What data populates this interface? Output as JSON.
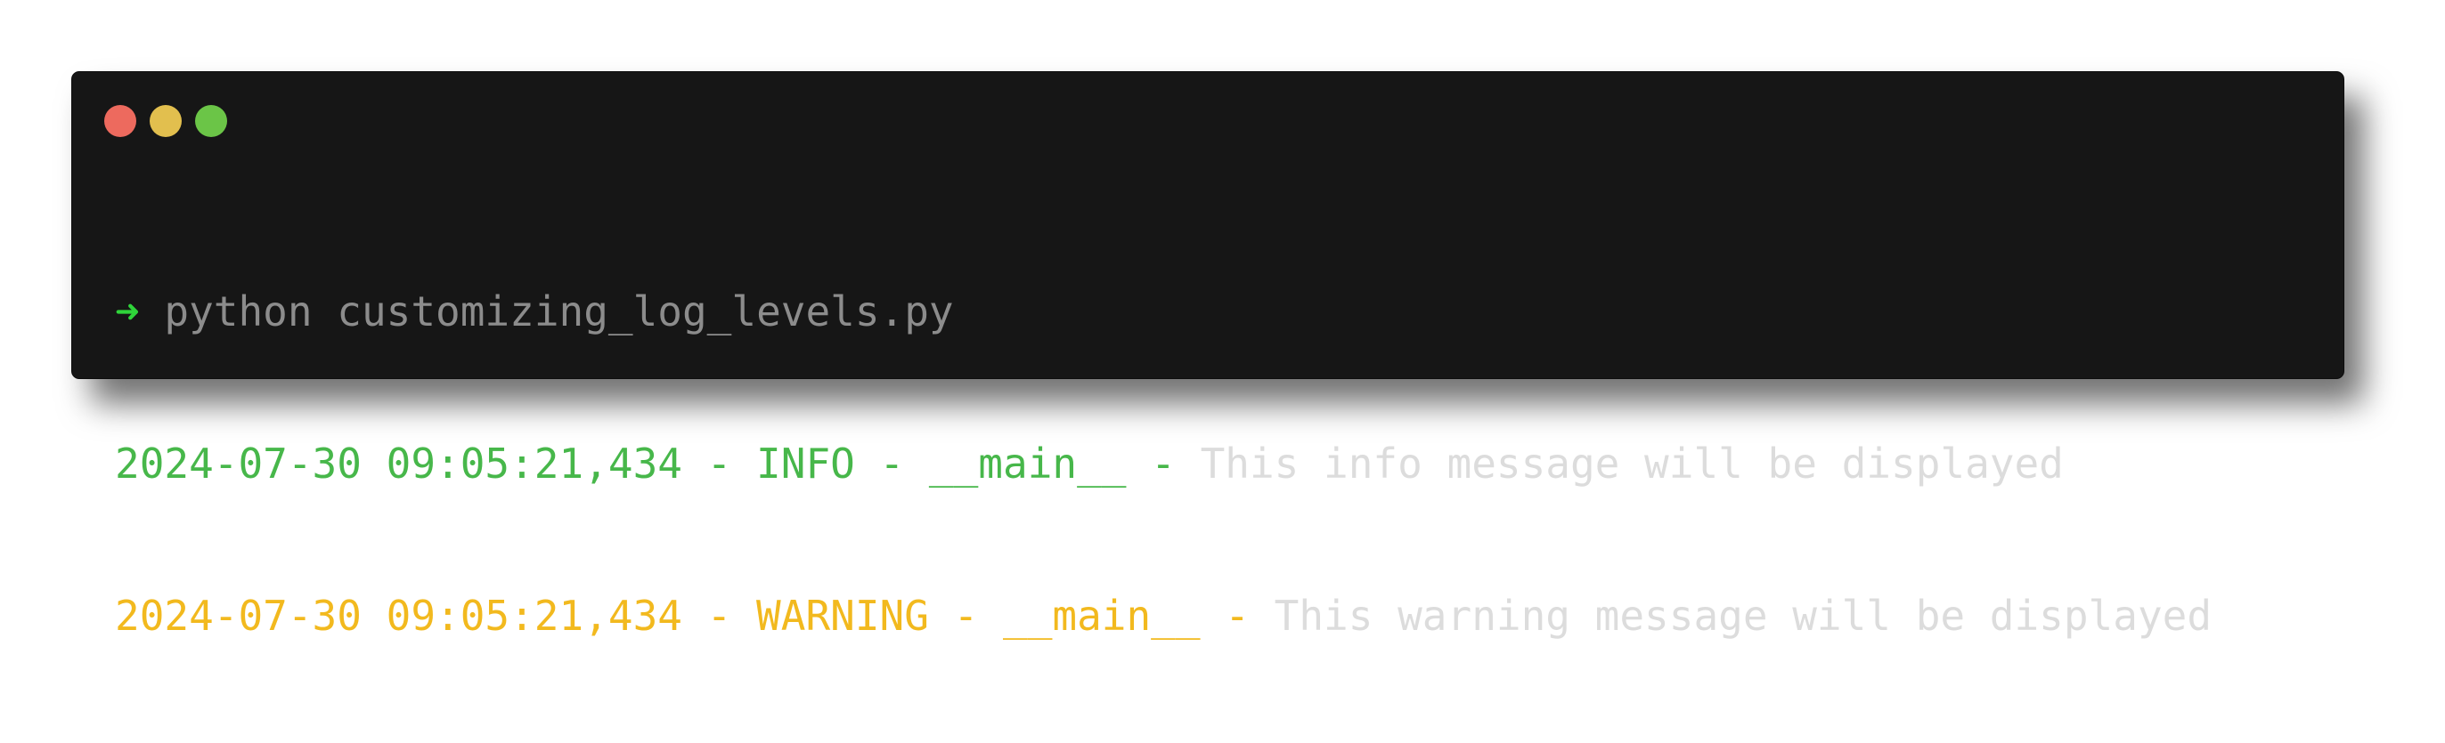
{
  "window": {
    "buttons": {
      "close": "close",
      "minimize": "minimize",
      "maximize": "maximize"
    },
    "colors": {
      "close": "#ed6a5e",
      "minimize": "#e2bf4e",
      "maximize": "#6bc547",
      "background": "#161616"
    }
  },
  "prompt": {
    "arrow": "➜",
    "command": "python customizing_log_levels.py",
    "arrow_color": "#2fd53a"
  },
  "output": [
    {
      "level": "INFO",
      "prefix": "2024-07-30 09:05:21,434 - INFO - __main__ - ",
      "message": "This info message will be displayed",
      "color": "#47b74a"
    },
    {
      "level": "WARNING",
      "prefix": "2024-07-30 09:05:21,434 - WARNING - __main__ - ",
      "message": "This warning message will be displayed",
      "color": "#f2b91e"
    }
  ]
}
